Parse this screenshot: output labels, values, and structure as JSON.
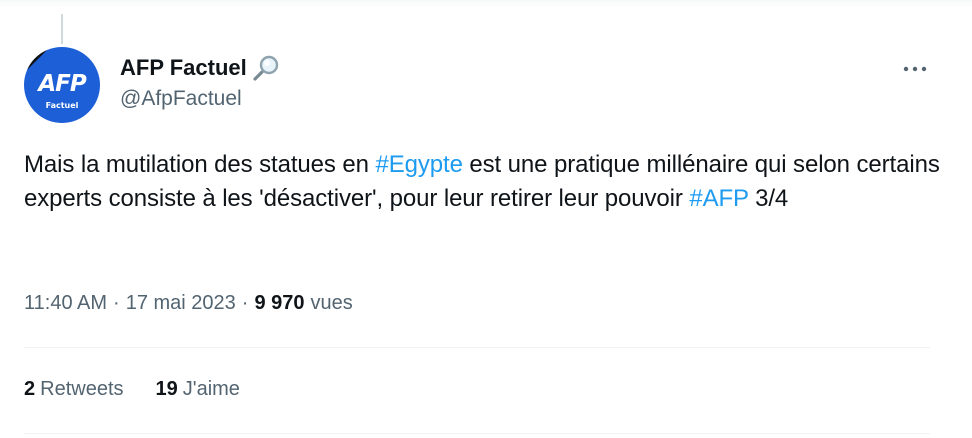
{
  "author": {
    "display_name": "AFP Factuel",
    "handle": "@AfpFactuel",
    "avatar_logo": "AFP",
    "avatar_subtitle": "Factuel",
    "badge_icon": "magnifying-glass-icon"
  },
  "tweet": {
    "segments": [
      {
        "text": "Mais la mutilation des statues en ",
        "type": "text"
      },
      {
        "text": "#Egypte",
        "type": "hashtag"
      },
      {
        "text": " est une pratique millénaire qui selon certains experts consiste à les 'désactiver', pour leur retirer leur pouvoir ",
        "type": "text"
      },
      {
        "text": "#AFP",
        "type": "hashtag"
      },
      {
        "text": " 3/4",
        "type": "text"
      }
    ]
  },
  "meta": {
    "time": "11:40 AM",
    "separator": "·",
    "date": "17 mai 2023",
    "views_count": "9 970",
    "views_label": "vues"
  },
  "stats": {
    "retweets_count": "2",
    "retweets_label": "Retweets",
    "likes_count": "19",
    "likes_label": "J'aime"
  },
  "colors": {
    "hashtag": "#1d9bf0",
    "secondary_text": "#536471",
    "avatar_bg": "#1d5fd6"
  }
}
